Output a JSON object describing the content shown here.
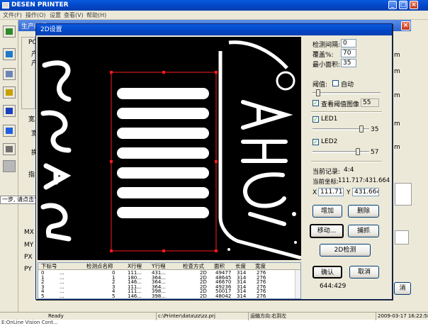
{
  "app": {
    "title": "DESEN PRINTER",
    "menu": [
      "文件(F)",
      "操作(O)",
      "设置",
      "查看(V)",
      "帮助(H)"
    ],
    "window_buttons": [
      "_",
      "□",
      "×"
    ]
  },
  "sub_window": {
    "title": "生产编辑",
    "close": "×",
    "labels": [
      "PC",
      "产",
      "产",
      "宽",
      "宽",
      "换",
      "指"
    ],
    "right_letters": [
      "m",
      "m",
      "m",
      "m",
      "m"
    ],
    "position_labels": [
      "MX",
      "MY",
      "PX",
      "PY"
    ],
    "hint": "一步, 请点击\"",
    "bottom_right_btn": "消"
  },
  "dialog": {
    "title": "2D设置",
    "detect_interval_label": "检测间隔:",
    "detect_interval_value": "0",
    "coverage_label": "覆盖%:",
    "coverage_value": "70",
    "min_area_label": "最小面积:",
    "min_area_value": "35",
    "threshold_label": "阈值:",
    "auto_label": "自动",
    "view_threshold_label": "查看阈值图像",
    "view_threshold_value": "55",
    "threshold_level": 0.08,
    "led1_label": "LED1",
    "led1_value": "35",
    "led1_level": 0.86,
    "led2_label": "LED2",
    "led2_value": "57",
    "led2_level": 0.8,
    "current_record_label": "当前记录:",
    "current_record_value": "4:4",
    "current_coord_label": "当前坐标:",
    "current_coord_value": "111.717:431.664",
    "x_label": "X",
    "x_value": "111.717",
    "y_label": "Y",
    "y_value": "431.664",
    "buttons": {
      "add": "增加",
      "delete": "删除",
      "move": "移动...",
      "capture": "捕抓",
      "detect2d": "2D检测",
      "ok": "确认",
      "cancel": "取消"
    },
    "cursor_readout": "644:429"
  },
  "table": {
    "headers": [
      "下标号",
      "检测点名称",
      "X行程",
      "Y行程",
      "检查方式",
      "面积",
      "长度",
      "宽度"
    ],
    "rows": [
      [
        "0",
        "...",
        "0",
        "111...",
        "431...",
        "2D",
        "49477",
        "314",
        "276"
      ],
      [
        "1",
        "...",
        "1",
        "180...",
        "364...",
        "2D",
        "48645",
        "314",
        "276"
      ],
      [
        "2",
        "...",
        "2",
        "146...",
        "364...",
        "2D",
        "46670",
        "314",
        "276"
      ],
      [
        "3",
        "...",
        "3",
        "111...",
        "364...",
        "2D",
        "49236",
        "314",
        "276"
      ],
      [
        "4",
        "...",
        "4",
        "111...",
        "398...",
        "2D",
        "50017",
        "314",
        "276"
      ],
      [
        "5",
        "...",
        "5",
        "146...",
        "398...",
        "2D",
        "48042",
        "314",
        "276"
      ]
    ]
  },
  "status": {
    "ready": "Ready",
    "path": "c:\\Printer\\data\\zz\\zz.prj",
    "direction": "运输方向:右到左",
    "datetime": "2009-03-17 16:22:58"
  },
  "taskbar_text": "E:OnLine Vision Cont...",
  "colors": {
    "title_blue": "#0346c6",
    "dialog_bg": "#ece9d8",
    "roi_red": "#ff1a1a"
  }
}
